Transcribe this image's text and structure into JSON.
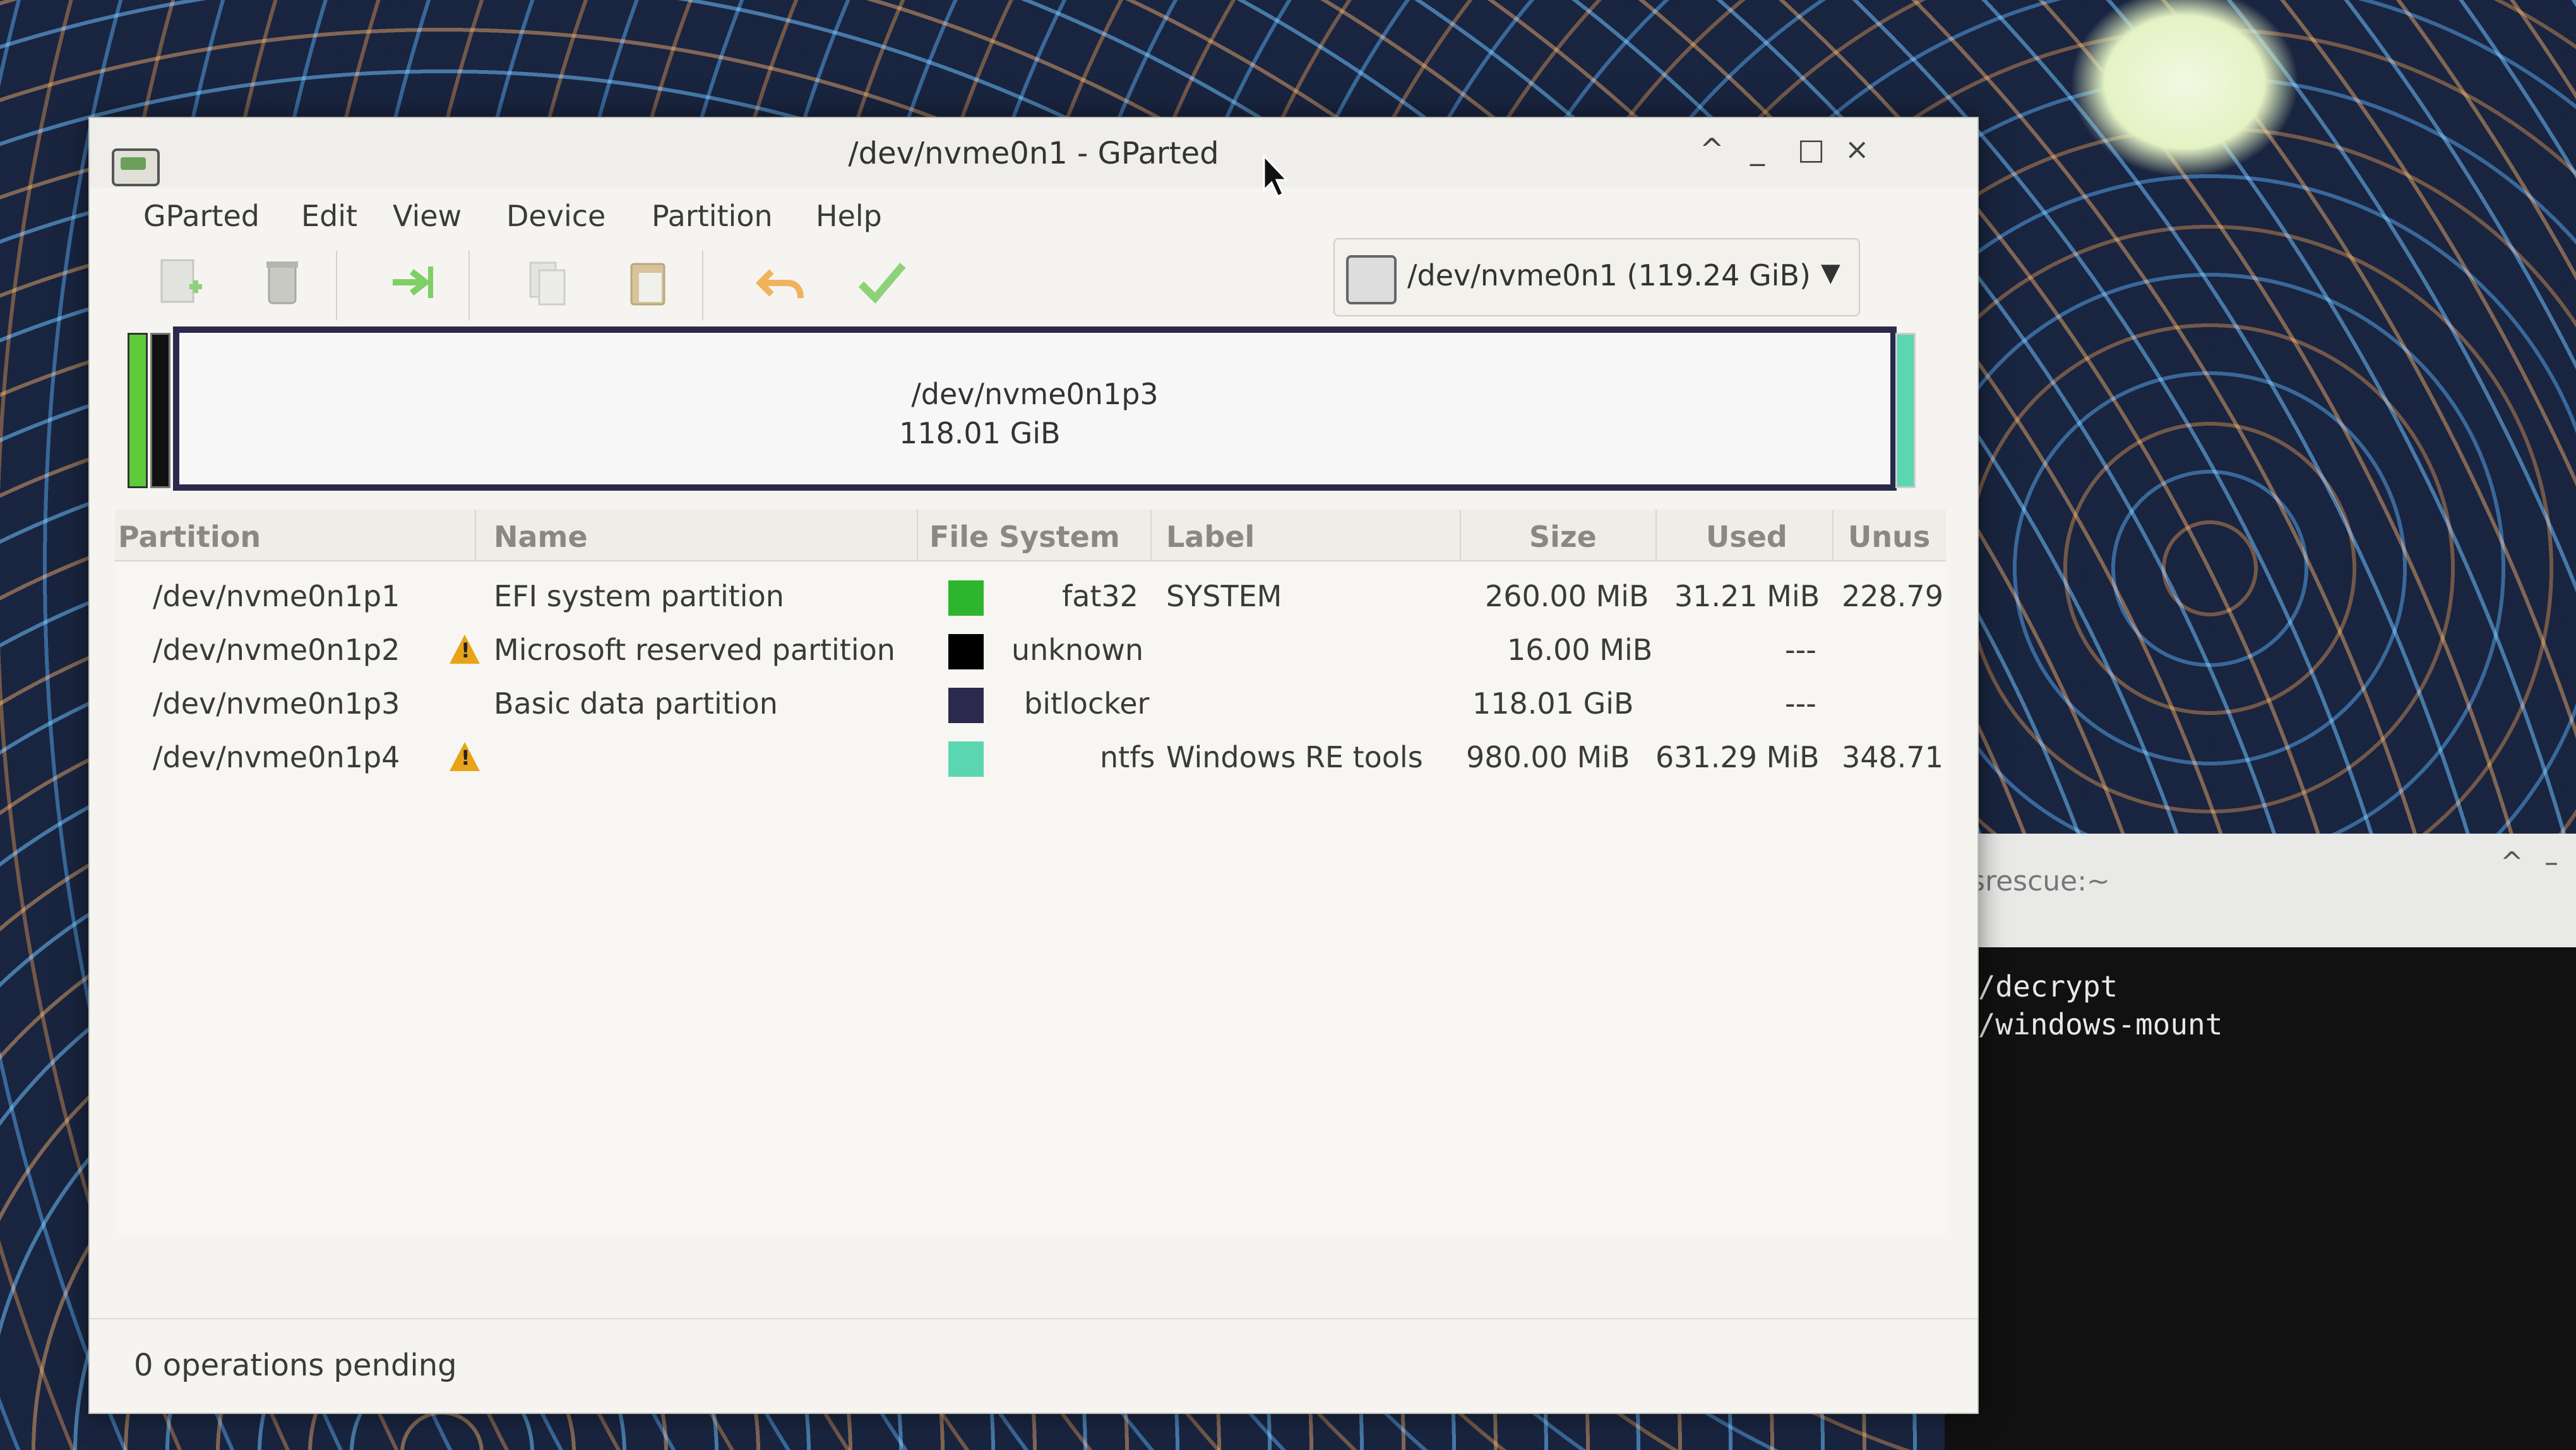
{
  "window": {
    "title": "/dev/nvme0n1 - GParted",
    "controls": [
      "^",
      "_",
      "□",
      "×"
    ]
  },
  "menu": [
    "GParted",
    "Edit",
    "View",
    "Device",
    "Partition",
    "Help"
  ],
  "toolbar": {
    "icons": [
      "new-icon",
      "delete-icon",
      "resize-move-icon",
      "copy-icon",
      "paste-icon",
      "undo-icon",
      "apply-icon"
    ],
    "device_selector": "/dev/nvme0n1 (119.24 GiB)"
  },
  "disk_map": {
    "main_partition_name": "/dev/nvme0n1p3",
    "main_partition_size": "118.01 GiB"
  },
  "table": {
    "columns": [
      "Partition",
      "Name",
      "File System",
      "Label",
      "Size",
      "Used",
      "Unus"
    ],
    "rows": [
      {
        "partition": "/dev/nvme0n1p1",
        "warning": false,
        "name": "EFI system partition",
        "fs_color": "#2db52d",
        "fs": "fat32",
        "label": "SYSTEM",
        "size": "260.00 MiB",
        "used": "31.21 MiB",
        "unused": "228.79"
      },
      {
        "partition": "/dev/nvme0n1p2",
        "warning": true,
        "name": "Microsoft reserved partition",
        "fs_color": "#000000",
        "fs": "unknown",
        "label": "",
        "size": "16.00 MiB",
        "used": "---",
        "unused": ""
      },
      {
        "partition": "/dev/nvme0n1p3",
        "warning": false,
        "name": "Basic data partition",
        "fs_color": "#2b2a4c",
        "fs": "bitlocker",
        "label": "",
        "size": "118.01 GiB",
        "used": "---",
        "unused": ""
      },
      {
        "partition": "/dev/nvme0n1p4",
        "warning": true,
        "name": "",
        "fs_color": "#5ad6b0",
        "fs": "ntfs",
        "label": "Windows RE tools",
        "size": "980.00 MiB",
        "used": "631.29 MiB",
        "unused": "348.71"
      }
    ]
  },
  "status": "0 operations pending",
  "terminal": {
    "title": "ysrescue:~",
    "controls": [
      "^",
      "–"
    ],
    "lines": [
      "a/decrypt",
      "a/windows-mount"
    ]
  }
}
